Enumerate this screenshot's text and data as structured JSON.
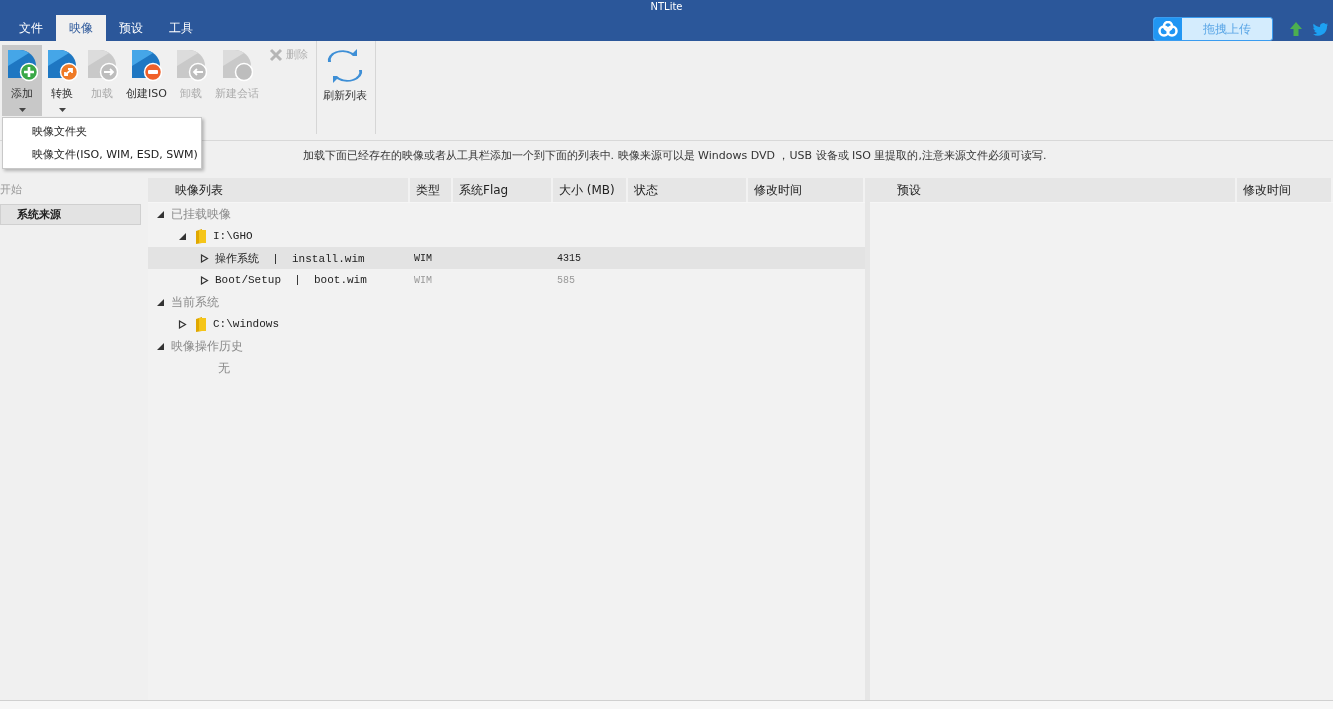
{
  "window": {
    "title": "NTLite"
  },
  "menu_tabs": [
    {
      "label": "文件",
      "selected": false
    },
    {
      "label": "映像",
      "selected": true
    },
    {
      "label": "预设",
      "selected": false
    },
    {
      "label": "工具",
      "selected": false
    }
  ],
  "upload_button": {
    "label": "拖拽上传"
  },
  "ribbon": {
    "groups": [
      {
        "buttons": [
          {
            "label": "添加",
            "kind": "add",
            "disabled": false,
            "dropdown": true,
            "open": true
          },
          {
            "label": "转换",
            "kind": "convert",
            "disabled": false,
            "dropdown": true,
            "open": false
          },
          {
            "label": "加载",
            "kind": "mount",
            "disabled": true,
            "dropdown": false,
            "open": false
          },
          {
            "label": "创建ISO",
            "kind": "iso",
            "disabled": false,
            "dropdown": false,
            "open": false
          },
          {
            "label": "卸载",
            "kind": "unmount",
            "disabled": true,
            "dropdown": false,
            "open": false
          },
          {
            "label": "新建会话",
            "kind": "session",
            "disabled": true,
            "dropdown": false,
            "open": false
          },
          {
            "label": "删除",
            "kind": "delete",
            "disabled": true
          }
        ]
      },
      {
        "buttons": [
          {
            "label": "刷新列表",
            "kind": "refresh",
            "disabled": false,
            "dropdown": false,
            "open": false
          }
        ]
      }
    ]
  },
  "dropdown_menu": {
    "items": [
      "映像文件夹",
      "映像文件(ISO, WIM, ESD, SWM)"
    ]
  },
  "info_text": "加载下面已经存在的映像或者从工具栏添加一个到下面的列表中. 映像来源可以是 Windows DVD ，USB 设备或 ISO 里提取的,注意来源文件必须可读写.",
  "sidebar": {
    "header": "开始",
    "items": [
      {
        "label": "系统来源",
        "selected": true
      }
    ]
  },
  "image_table": {
    "columns": [
      "映像列表",
      "类型",
      "系统Flag",
      "大小 (MB)",
      "状态",
      "修改时间"
    ],
    "tree": [
      {
        "kind": "group",
        "label": "已挂载映像",
        "expanded": true,
        "children": [
          {
            "kind": "folder",
            "label": "I:\\GHO",
            "expanded": true,
            "children": [
              {
                "kind": "image",
                "label": "操作系统  |  install.wim",
                "type": "WIM",
                "size": "4315",
                "expanded": false,
                "selected": true
              },
              {
                "kind": "image",
                "label": "Boot/Setup  |  boot.wim",
                "type": "WIM",
                "size": "585",
                "expanded": false,
                "selected": false
              }
            ]
          }
        ]
      },
      {
        "kind": "group",
        "label": "当前系统",
        "expanded": true,
        "children": [
          {
            "kind": "folder",
            "label": "C:\\windows",
            "expanded": false
          }
        ]
      },
      {
        "kind": "group",
        "label": "映像操作历史",
        "expanded": true,
        "children": [
          {
            "kind": "empty",
            "label": "无"
          }
        ]
      }
    ]
  },
  "presets_table": {
    "columns": [
      "预设",
      "修改时间"
    ]
  }
}
